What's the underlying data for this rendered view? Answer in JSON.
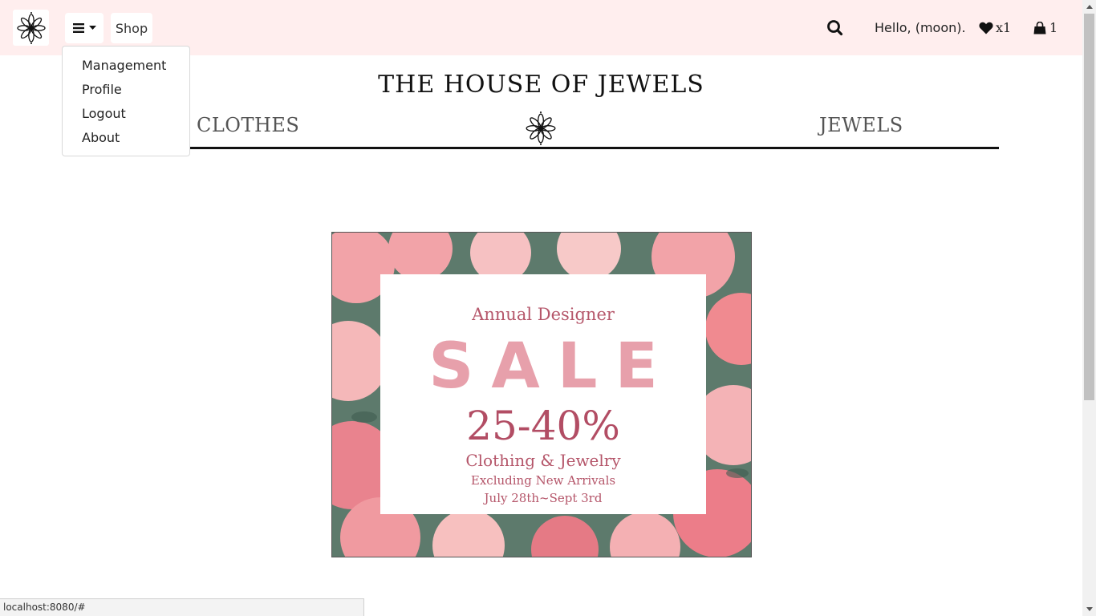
{
  "header": {
    "shop_label": "Shop",
    "greeting": "Hello, (moon).",
    "wishlist_count": "x1",
    "cart_count": "1",
    "background": "#ffeeee"
  },
  "dropdown": {
    "items": [
      "Management",
      "Profile",
      "Logout",
      "About"
    ]
  },
  "site": {
    "title": "THE HOUSE OF JEWELS",
    "categories": {
      "left": "CLOTHES",
      "right": "JEWELS"
    }
  },
  "banner": {
    "line1": "Annual Designer",
    "headline": "SALE",
    "discount": "25-40%",
    "line2": "Clothing & Jewelry",
    "line3": "Excluding New Arrivals",
    "line4": "July 28th~Sept 3rd"
  },
  "status": {
    "url": "localhost:8080/#"
  },
  "icons": [
    "flower-logo-icon",
    "hamburger-icon",
    "caret-down-icon",
    "search-icon",
    "heart-icon",
    "shopping-bag-icon"
  ]
}
